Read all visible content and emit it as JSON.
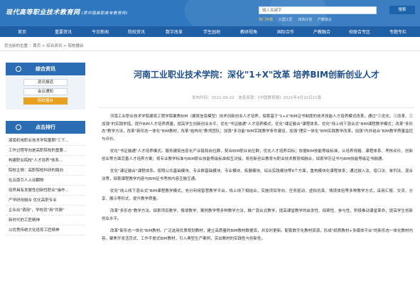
{
  "header": {
    "site_title": "现代高等职业技术教育网",
    "site_subtitle": "(原中国高职高专教育网)",
    "search_placeholder": "输入关键字",
    "search_button": "搜索",
    "hot_label": "热门专题",
    "hot_words": [
      "大国工匠",
      "双高计划",
      "产教融合"
    ]
  },
  "nav": {
    "items": [
      "首页",
      "重要资讯",
      "今日新闻",
      "院校资讯",
      "数字改革",
      "学生园地",
      "教研视角",
      "国际合作",
      "产教融合",
      "校联合专区",
      "专题专栏"
    ]
  },
  "breadcrumb": {
    "text": "您当前的位置 ：首页 > 综合资讯 > 院校播台"
  },
  "sidebar": {
    "section1_title": "综合资讯",
    "section1_items": [
      "资讯报道",
      "会议通知",
      "院校播台"
    ],
    "section2_title": "点击排行",
    "rank_items": [
      "湖南机电职业技术学院董期\"三下...",
      "工作过程导向是高职院校的重要...",
      "构建职业院校\"人才培养\"体系...",
      "院校主情：高职院校科研的路向",
      "在云南引人上动翻物",
      "培养具有发展性创新性职业\"操作...",
      "产学研用融合 优化高职专业",
      "企业出\"调用\"，学校就\"用\"共振\"",
      "新时代的工匠精神",
      "以优秀传统文化培育工匠精神"
    ]
  },
  "article": {
    "title": "河南工业职业技术学院：深化\"1+X\"改革 培养BIM创新创业人才",
    "meta_time": "发布时间：2021-09-22",
    "meta_source": "信息来源：《中国教育报》2021年9月22日11版",
    "paragraphs": [
      "河南工业职业技术学院建筑工程学院聚焦BIM（建筑信息模型）技术创新创业人才培养，探索基于\"1+X\"BIM证书制度的技术技能人才培养模式改革，通过\"三优化、三改革、三加强\"的实践举措，提升BIM人才培养质量，提高学生创新创业水平。优化\"书证融通\"人才培养模式，优化\"课证融合\"课程体系，优化\"线上线下混合式\"BIM课程教学模式；改革\"多形态\"教学方法，改革\"新形态一体化\"BIM教材，改革\"结构化\"教师团队；加强\"多功能\"BIM实践教学条件建设，加强\"理实一体化\"BIM实践教学改革，加强\"内外结合\"BIM教学质量监控与评价。",
      "优化\"书证融通\"人才培养模式。服务建筑信息化产业链和岗位群，契合BIM职业岗位群，优化人才培养目标；依据BIM技能等级标准，从培养规格、课程体系、考核评价、创新创业等方面完善人才培养方案；将专业教学标准与BIM职业技能等级标准相互对接，将创新创业教育与职业技术教育相融合，探索学历证书与BIM技能等级证书融通。",
      "优化\"课证融合\"课程体系。按照公共基础模块、专业群基础模块、专业模块、拓展模块、综合实践模块等6个方面，重构模块化课程体系；通过融入法、增口法、单列法、混合法等，探索课程教学内容与BIM证书考核内容互融互通。",
      "优化\"线上线下混合式\"BIM课程教学模式。充分利用智慧教学平台，线上线下相结合，实施项目导向、任务驱动、虚拟仿真、情境体验等多种教学方式，采用汇报、交流、分享、展示等形式，提升教学质量。",
      "改革\"多形态\"教学方法。探索项目教学、情境教学、案例教学等多种教学方法，推广混合式教学，提高课堂教学的启发性、探索性、参与性，积极推动课堂革命，提高学生创新创业水平。",
      "改革\"新形态一体化\"BIM教材。广泛选用优质规划教材，建立高质量的BIM教材数据库，并及时更新。配套数字化教材资源，形成\"纸质教材+多媒体平台\"的新形态一体化教材内容。聚焦开发活页式、工作手册式BIM教材，引入典型生产案例，突出教材的实践性与创新性。"
    ]
  },
  "colors": {
    "header_blue": "#2f78bf",
    "nav_blue": "#1f5fa6",
    "title_blue": "#1f4f8a",
    "active_orange": "#e8a020"
  }
}
